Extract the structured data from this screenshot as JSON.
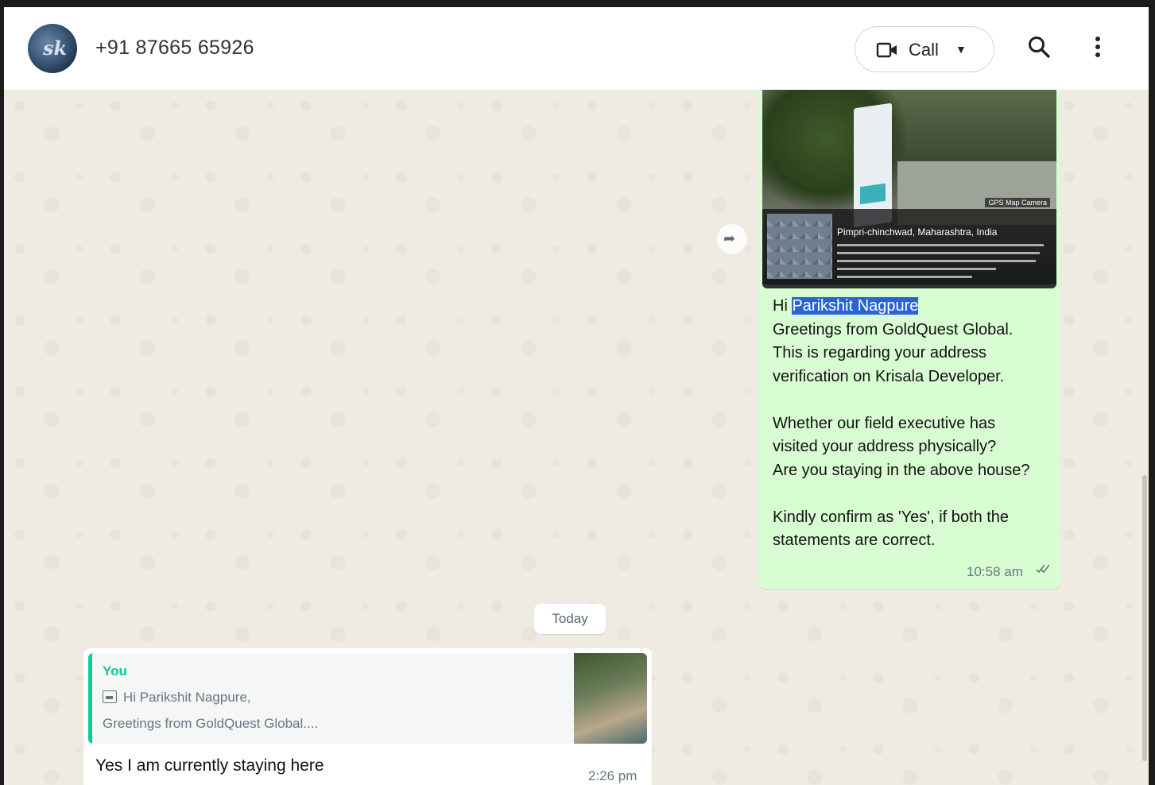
{
  "header": {
    "contact_name": "+91 87665 65926",
    "call_label": "Call"
  },
  "outgoing_message": {
    "image": {
      "gps_tag": "GPS Map Camera",
      "location": "Pimpri-chinchwad, Maharashtra, India"
    },
    "greeting_prefix": "Hi ",
    "highlighted_name": "Parikshit Nagpure",
    "line2": "Greetings from GoldQuest Global.",
    "line3": "This is regarding your address",
    "line4": "verification on Krisala Developer.",
    "line5": "Whether our field executive has",
    "line6": "visited your address physically?",
    "line7": "Are you staying in the above house?",
    "line8": "Kindly confirm as 'Yes', if both the",
    "line9": "statements are correct.",
    "time": "10:58 am",
    "status_icon": "double-check-icon"
  },
  "date_separator": "Today",
  "incoming_message": {
    "quoted": {
      "author": "You",
      "line1": "Hi Parikshit Nagpure,",
      "line2": "Greetings from GoldQuest Global...."
    },
    "text": "Yes I am currently staying here",
    "time": "2:26 pm"
  },
  "colors": {
    "outgoing_bubble": "#d9fdd3",
    "incoming_bubble": "#ffffff",
    "chat_background": "#efeae2",
    "quote_accent": "#06cf9c",
    "selection_highlight": "#2a62d8"
  }
}
